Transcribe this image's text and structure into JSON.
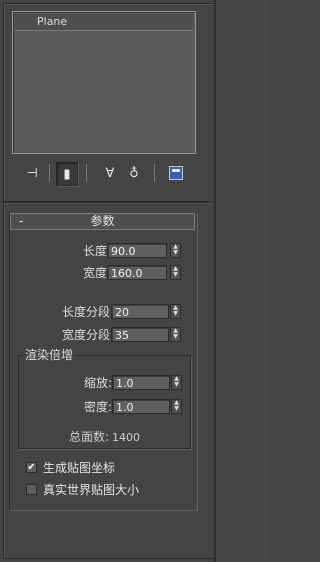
{
  "modifier_stack": {
    "items": [
      "Plane"
    ]
  },
  "toolbar": {
    "buttons": [
      {
        "name": "pin-stack",
        "glyph": "⊣"
      },
      {
        "name": "show-end-result",
        "glyph": "▮"
      },
      {
        "name": "make-unique",
        "glyph": "∀"
      },
      {
        "name": "remove-modifier",
        "glyph": "♁"
      },
      {
        "name": "configure-modifier-sets",
        "glyph": ""
      }
    ]
  },
  "parameters": {
    "rollout_toggle": "-",
    "title": "参数",
    "length_label": "长度:",
    "length_value": "90.0",
    "width_label": "宽度:",
    "width_value": "160.0",
    "length_segs_label": "长度分段:",
    "length_segs_value": "20",
    "width_segs_label": "宽度分段:",
    "width_segs_value": "35",
    "render_group": {
      "title": "渲染倍增",
      "scale_label": "缩放:",
      "scale_value": "1.0",
      "density_label": "密度:",
      "density_value": "1.0",
      "total_faces_label": "总面数:",
      "total_faces_value": "1400"
    },
    "gen_mapping_coords": {
      "label": "生成贴图坐标",
      "checked": true,
      "mark": "✔"
    },
    "real_world_map_size": {
      "label": "真实世界贴图大小",
      "checked": false,
      "mark": ""
    }
  }
}
